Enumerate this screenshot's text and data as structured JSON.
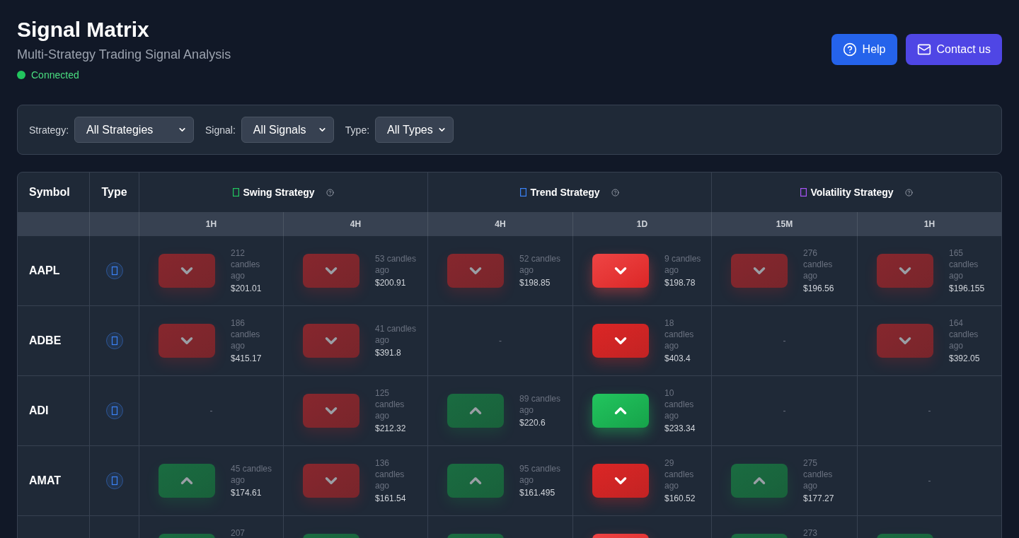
{
  "header": {
    "title": "Signal Matrix",
    "subtitle": "Multi-Strategy Trading Signal Analysis",
    "status": {
      "label": "Connected",
      "connected": true
    }
  },
  "actions": [
    {
      "label": "Help",
      "kind": "help"
    },
    {
      "label": "Contact us",
      "kind": "contact"
    }
  ],
  "filters": [
    {
      "label": "Strategy:",
      "value": "All Strategies"
    },
    {
      "label": "Signal:",
      "value": "All Signals"
    },
    {
      "label": "Type:",
      "value": "All Types"
    }
  ],
  "table": {
    "columns": {
      "symbol": "Symbol",
      "type": "Type"
    },
    "strategies": [
      {
        "name": "Swing Strategy",
        "color": "#22c55e",
        "timeframes": [
          "1H",
          "4H"
        ]
      },
      {
        "name": "Trend Strategy",
        "color": "#3b82f6",
        "timeframes": [
          "4H",
          "1D"
        ]
      },
      {
        "name": "Volatility Strategy",
        "color": "#a855f7",
        "timeframes": [
          "15M",
          "1H"
        ]
      }
    ],
    "rows": [
      {
        "symbol": "AAPL",
        "partial": false,
        "cells": [
          {
            "kind": "sell",
            "faded": true,
            "bright": false,
            "candles": "212 candles ago",
            "price": "$201.01"
          },
          {
            "kind": "sell",
            "faded": true,
            "bright": false,
            "candles": "53 candles ago",
            "price": "$200.91"
          },
          {
            "kind": "sell",
            "faded": true,
            "bright": false,
            "candles": "52 candles ago",
            "price": "$198.85"
          },
          {
            "kind": "sell",
            "faded": false,
            "bright": true,
            "candles": "9 candles ago",
            "price": "$198.78"
          },
          {
            "kind": "sell",
            "faded": true,
            "bright": false,
            "candles": "276 candles ago",
            "price": "$196.56"
          },
          {
            "kind": "sell",
            "faded": true,
            "bright": false,
            "candles": "165 candles ago",
            "price": "$196.155"
          }
        ]
      },
      {
        "symbol": "ADBE",
        "partial": false,
        "cells": [
          {
            "kind": "sell",
            "faded": true,
            "bright": false,
            "candles": "186 candles ago",
            "price": "$415.17"
          },
          {
            "kind": "sell",
            "faded": true,
            "bright": false,
            "candles": "41 candles ago",
            "price": "$391.8"
          },
          {
            "kind": "empty",
            "text": "-"
          },
          {
            "kind": "sell",
            "faded": false,
            "bright": false,
            "candles": "18 candles ago",
            "price": "$403.4"
          },
          {
            "kind": "empty",
            "text": "-"
          },
          {
            "kind": "sell",
            "faded": true,
            "bright": false,
            "candles": "164 candles ago",
            "price": "$392.05"
          }
        ]
      },
      {
        "symbol": "ADI",
        "partial": false,
        "cells": [
          {
            "kind": "empty",
            "text": "-"
          },
          {
            "kind": "sell",
            "faded": true,
            "bright": false,
            "candles": "125 candles ago",
            "price": "$212.32"
          },
          {
            "kind": "buy",
            "faded": true,
            "bright": false,
            "candles": "89 candles ago",
            "price": "$220.6"
          },
          {
            "kind": "buy",
            "faded": false,
            "bright": true,
            "candles": "10 candles ago",
            "price": "$233.34"
          },
          {
            "kind": "empty",
            "text": "-"
          },
          {
            "kind": "empty",
            "text": "-"
          }
        ]
      },
      {
        "symbol": "AMAT",
        "partial": false,
        "cells": [
          {
            "kind": "buy",
            "faded": true,
            "bright": false,
            "candles": "45 candles ago",
            "price": "$174.61"
          },
          {
            "kind": "sell",
            "faded": true,
            "bright": false,
            "candles": "136 candles ago",
            "price": "$161.54"
          },
          {
            "kind": "buy",
            "faded": true,
            "bright": false,
            "candles": "95 candles ago",
            "price": "$161.495"
          },
          {
            "kind": "sell",
            "faded": false,
            "bright": false,
            "candles": "29 candles ago",
            "price": "$160.52"
          },
          {
            "kind": "buy",
            "faded": true,
            "bright": false,
            "candles": "275 candles ago",
            "price": "$177.27"
          },
          {
            "kind": "empty",
            "text": "-"
          }
        ]
      },
      {
        "partial": true,
        "cells": [
          {
            "kind": "buy",
            "faded": true,
            "bright": false,
            "candles": "207"
          },
          {
            "kind": "buy",
            "faded": true,
            "bright": false
          },
          {
            "kind": "buy",
            "faded": true,
            "bright": false
          },
          {
            "kind": "sell",
            "faded": false,
            "bright": true
          },
          {
            "kind": "buy",
            "faded": true,
            "bright": false,
            "candles": "273"
          },
          {
            "kind": "buy",
            "faded": true,
            "bright": false
          }
        ]
      }
    ]
  }
}
